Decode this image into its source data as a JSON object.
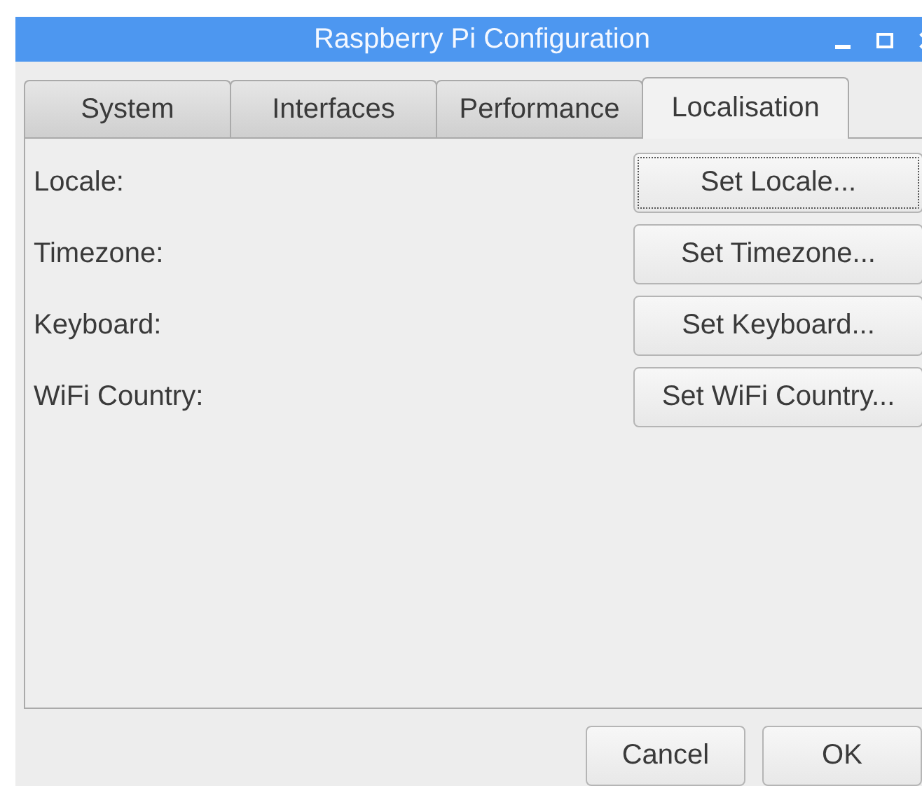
{
  "window": {
    "title": "Raspberry Pi Configuration"
  },
  "tabs": [
    {
      "label": "System",
      "selected": false
    },
    {
      "label": "Interfaces",
      "selected": false
    },
    {
      "label": "Performance",
      "selected": false
    },
    {
      "label": "Localisation",
      "selected": true
    }
  ],
  "rows": [
    {
      "label": "Locale:",
      "button": "Set Locale...",
      "focused": true
    },
    {
      "label": "Timezone:",
      "button": "Set Timezone...",
      "focused": false
    },
    {
      "label": "Keyboard:",
      "button": "Set Keyboard...",
      "focused": false
    },
    {
      "label": "WiFi Country:",
      "button": "Set WiFi Country...",
      "focused": false
    }
  ],
  "buttons": [
    "Cancel",
    "OK"
  ]
}
